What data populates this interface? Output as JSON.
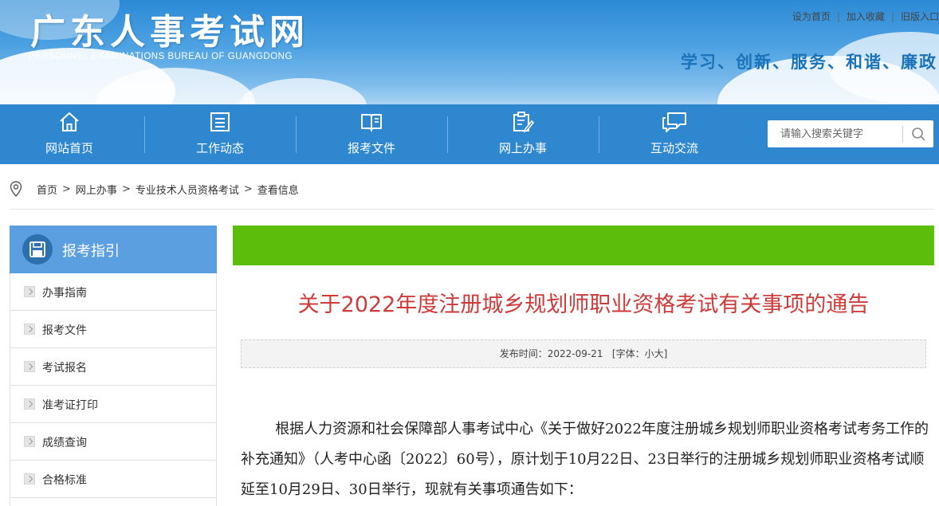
{
  "header": {
    "site_title": "广东人事考试网",
    "site_subtitle": "PERSONNEL EXAMINATIONS BUREAU OF GUANGDONG",
    "top_links": [
      "设为首页",
      "加入收藏",
      "旧版入口"
    ],
    "slogan": "学习、创新、服务、和谐、廉政"
  },
  "nav": {
    "items": [
      {
        "label": "网站首页",
        "icon": "home-icon"
      },
      {
        "label": "工作动态",
        "icon": "news-list-icon"
      },
      {
        "label": "报考文件",
        "icon": "open-book-icon"
      },
      {
        "label": "网上办事",
        "icon": "clipboard-edit-icon"
      },
      {
        "label": "互动交流",
        "icon": "chat-bubbles-icon"
      }
    ],
    "search_placeholder": "请输入搜索关键字"
  },
  "breadcrumb": {
    "items": [
      "首页",
      "网上办事",
      "专业技术人员资格考试",
      "查看信息"
    ],
    "separator": ">"
  },
  "sidebar": {
    "title": "报考指引",
    "items": [
      {
        "label": "办事指南"
      },
      {
        "label": "报考文件"
      },
      {
        "label": "考试报名"
      },
      {
        "label": "准考证打印"
      },
      {
        "label": "成绩查询"
      },
      {
        "label": "合格标准"
      }
    ]
  },
  "article": {
    "title": "关于2022年度注册城乡规划师职业资格考试有关事项的通告",
    "publish_label": "发布时间：",
    "publish_date": "2022-09-21",
    "font_size_label": "[字体：小大]",
    "body": "根据人力资源和社会保障部人事考试中心《关于做好2022年度注册城乡规划师职业资格考试考务工作的补充通知》（人考中心函〔2022〕60号），原计划于10月22日、23日举行的注册城乡规划师职业资格考试顺延至10月29日、30日举行，现就有关事项通告如下："
  },
  "colors": {
    "nav_bg": "#2f87cf",
    "sidebar_head": "#5b9fe0",
    "green_bar": "#5cbe0a",
    "title_red": "#cf3a3a",
    "slogan_blue": "#1a73b8"
  }
}
